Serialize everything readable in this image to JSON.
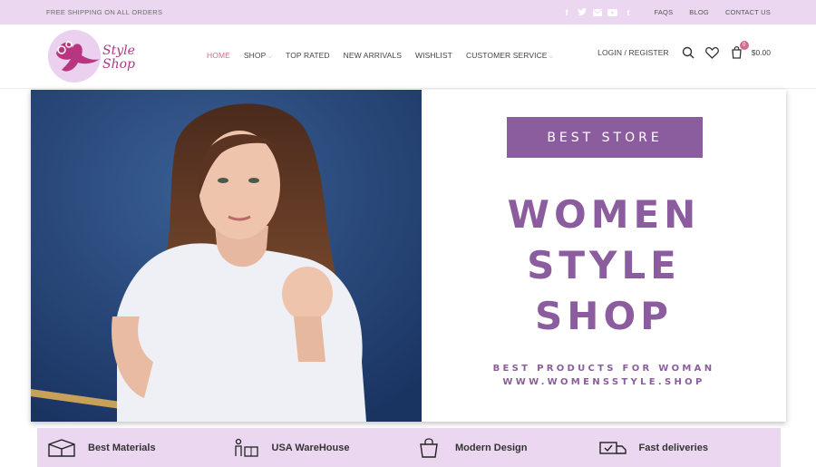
{
  "topbar": {
    "promo": "FREE SHIPPING ON ALL ORDERS",
    "social": [
      "facebook-icon",
      "twitter-icon",
      "email-icon",
      "youtube-icon",
      "tumblr-icon"
    ],
    "links": [
      "FAQS",
      "BLOG",
      "CONTACT US"
    ]
  },
  "header": {
    "logo_text_line1": "Style",
    "logo_text_line2": "Shop",
    "nav": [
      {
        "label": "HOME",
        "active": true,
        "dropdown": false
      },
      {
        "label": "SHOP",
        "active": false,
        "dropdown": true
      },
      {
        "label": "TOP RATED",
        "active": false,
        "dropdown": false
      },
      {
        "label": "NEW ARRIVALS",
        "active": false,
        "dropdown": false
      },
      {
        "label": "WISHLIST",
        "active": false,
        "dropdown": false
      },
      {
        "label": "CUSTOMER SERVICE",
        "active": false,
        "dropdown": true
      }
    ],
    "login_label": "LOGIN / REGISTER",
    "cart_count": "0",
    "cart_total": "$0.00"
  },
  "hero": {
    "badge": "BEST STORE",
    "headline": [
      "WOMEN",
      "STYLE",
      "SHOP"
    ],
    "subline1": "BEST PRODUCTS FOR WOMAN",
    "subline2": "WWW.WOMENSSTYLE.SHOP"
  },
  "features": [
    {
      "label": "Best Materials",
      "icon": "box-icon"
    },
    {
      "label": "USA WareHouse",
      "icon": "warehouse-icon"
    },
    {
      "label": "Modern Design",
      "icon": "shopping-bag-icon"
    },
    {
      "label": "Fast deliveries",
      "icon": "delivery-truck-icon"
    }
  ],
  "colors": {
    "topbar_bg": "#ebd8f0",
    "accent_purple": "#8b5d9e",
    "active_pink": "#cf6d8e"
  }
}
